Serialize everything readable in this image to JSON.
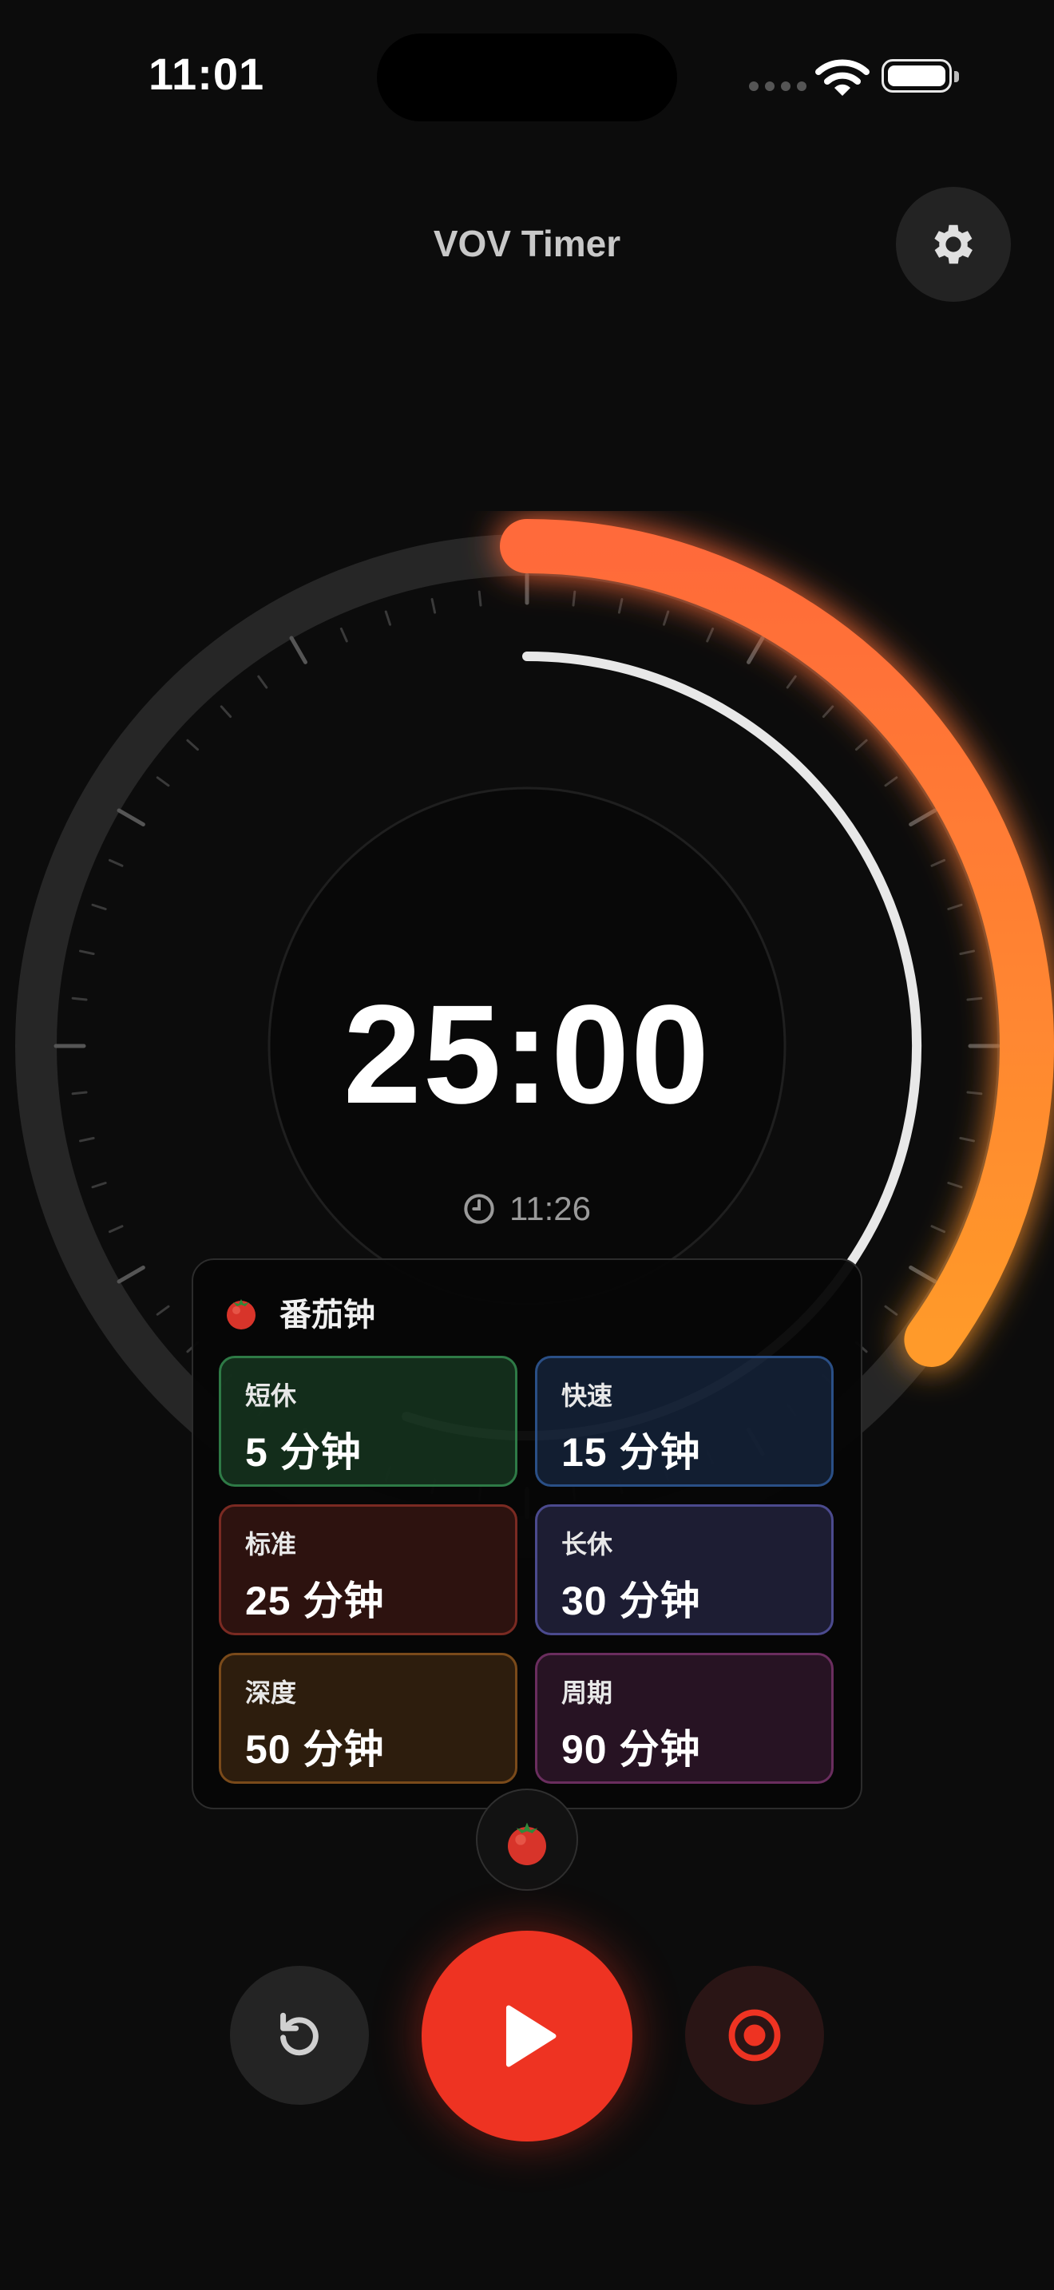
{
  "status_bar": {
    "time": "11:01"
  },
  "header": {
    "title": "VOV Timer",
    "settings_icon": "gear-icon"
  },
  "timer": {
    "remaining": "25:00",
    "end_time": "11:26",
    "end_time_icon": "clock-icon",
    "outer_progress": 0.35,
    "inner_progress": 0.55
  },
  "colors": {
    "accent_orange": "#ff8a2a",
    "play_red": "#ee3322",
    "background": "#0c0c0c"
  },
  "presets": {
    "title": "番茄钟",
    "icon": "tomato-icon",
    "items": [
      {
        "label": "短休",
        "value": "5 分钟",
        "color": "#2e7a46"
      },
      {
        "label": "快速",
        "value": "15 分钟",
        "color": "#2a4f86"
      },
      {
        "label": "标准",
        "value": "25 分钟",
        "color": "#7a2a22"
      },
      {
        "label": "长休",
        "value": "30 分钟",
        "color": "#4b4a8e"
      },
      {
        "label": "深度",
        "value": "50 分钟",
        "color": "#7a4a1a"
      },
      {
        "label": "周期",
        "value": "90 分钟",
        "color": "#6a2d5e"
      }
    ]
  },
  "controls": {
    "reset_icon": "reset-icon",
    "play_icon": "play-icon",
    "record_icon": "record-icon",
    "mode_icon": "tomato-icon"
  }
}
